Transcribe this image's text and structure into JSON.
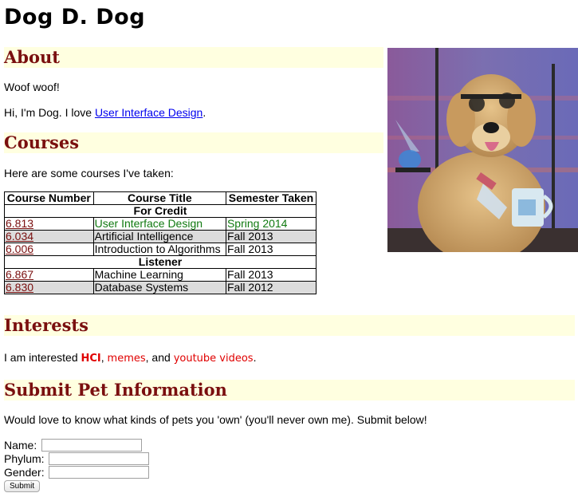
{
  "page_title": "Dog D. Dog",
  "about": {
    "heading": "About",
    "line1": "Woof woof!",
    "line2_prefix": "Hi, I'm Dog. I love ",
    "line2_link": "User Interface Design",
    "line2_suffix": "."
  },
  "courses": {
    "heading": "Courses",
    "intro": "Here are some courses I've taken:",
    "columns": [
      "Course Number",
      "Course Title",
      "Semester Taken"
    ],
    "groups": [
      {
        "label": "For Credit",
        "rows": [
          {
            "number": "6.813",
            "title": "User Interface Design",
            "semester": "Spring 2014"
          },
          {
            "number": "6.034",
            "title": "Artificial Intelligence",
            "semester": "Fall 2013"
          },
          {
            "number": "6.006",
            "title": "Introduction to Algorithms",
            "semester": "Fall 2013"
          }
        ]
      },
      {
        "label": "Listener",
        "rows": [
          {
            "number": "6.867",
            "title": "Machine Learning",
            "semester": "Fall 2013"
          },
          {
            "number": "6.830",
            "title": "Database Systems",
            "semester": "Fall 2012"
          }
        ]
      }
    ]
  },
  "interests": {
    "heading": "Interests",
    "prefix": "I am interested ",
    "item1": "HCI",
    "sep1": ", ",
    "item2": "memes",
    "sep2": ", and ",
    "item3": "youtube videos",
    "suffix": "."
  },
  "submit_pet": {
    "heading": "Submit Pet Information",
    "intro": "Would love to know what kinds of pets you 'own' (you'll never own me). Submit below!",
    "name_label": "Name:",
    "name_value": "",
    "phylum_label": "Phylum:",
    "phylum_value": "",
    "gender_label": "Gender:",
    "gender_value": "",
    "submit_label": "Submit"
  },
  "colors": {
    "heading_text": "#7a0f0f",
    "heading_bg": "#ffffe0",
    "link": "#0000ee",
    "interest_red": "#e00000",
    "course_green": "#117a11",
    "row_gray": "#dcdcdc"
  },
  "image": {
    "icon": "scientist-dog-photo"
  }
}
